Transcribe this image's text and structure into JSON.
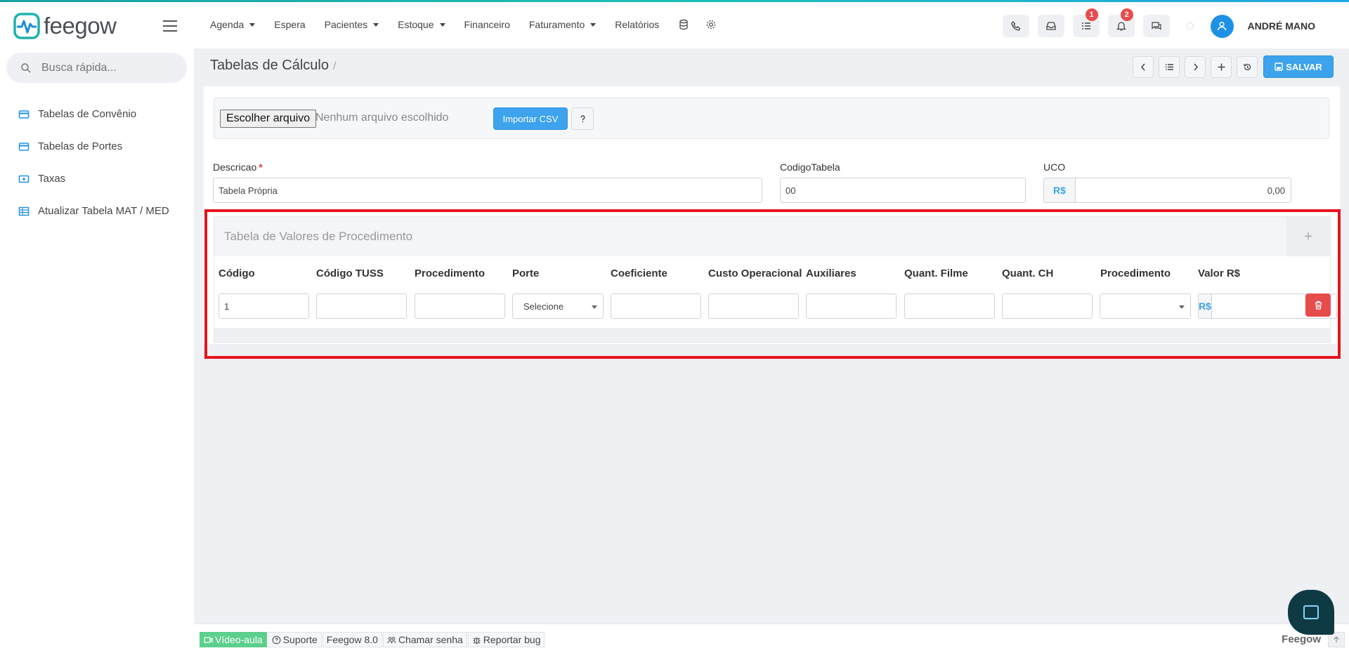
{
  "brand": {
    "name": "feegow",
    "accent": "#1cc0b5",
    "primary": "#3da3ec",
    "danger": "#e74c4c"
  },
  "nav": [
    {
      "label": "Agenda",
      "dropdown": true
    },
    {
      "label": "Espera",
      "dropdown": false
    },
    {
      "label": "Pacientes",
      "dropdown": true
    },
    {
      "label": "Estoque",
      "dropdown": true
    },
    {
      "label": "Financeiro",
      "dropdown": false
    },
    {
      "label": "Faturamento",
      "dropdown": true
    },
    {
      "label": "Relatórios",
      "dropdown": false
    }
  ],
  "top_right": {
    "tasks_badge": "1",
    "notifications_badge": "2",
    "user_name": "ANDRÉ MANO"
  },
  "sidebar": {
    "search_placeholder": "Busca rápida...",
    "items": [
      {
        "label": "Tabelas de Convênio",
        "icon": "card-icon"
      },
      {
        "label": "Tabelas de Portes",
        "icon": "card-icon"
      },
      {
        "label": "Taxas",
        "icon": "money-icon"
      },
      {
        "label": "Atualizar Tabela MAT / MED",
        "icon": "table-icon"
      }
    ]
  },
  "header": {
    "title": "Tabelas de Cálculo",
    "separator": "/",
    "save_label": "SALVAR"
  },
  "import": {
    "file_button": "Escolher arquivo",
    "file_status": "Nenhum arquivo escolhido",
    "import_button": "Importar CSV"
  },
  "form": {
    "descricao_label": "Descricao",
    "descricao_required": "*",
    "descricao_value": "Tabela Própria",
    "codigo_label": "CodigoTabela",
    "codigo_value": "00",
    "uco_label": "UCO",
    "uco_prefix": "R$",
    "uco_value": "0,00"
  },
  "procedures": {
    "title": "Tabela de Valores de Procedimento",
    "add_label": "+",
    "columns": [
      "Código",
      "Código TUSS",
      "Procedimento",
      "Porte",
      "Coeficiente",
      "Custo Operacional",
      "Auxiliares",
      "Quant. Filme",
      "Quant. CH",
      "Procedimento",
      "Valor R$"
    ],
    "row": {
      "codigo": "1",
      "porte_placeholder": "Selecione",
      "valor_prefix": "R$"
    }
  },
  "footer": {
    "links": [
      "Vídeo-aula",
      "Suporte",
      "Feegow 8.0",
      "Chamar senha",
      "Reportar bug"
    ],
    "brand": "Feegow"
  }
}
